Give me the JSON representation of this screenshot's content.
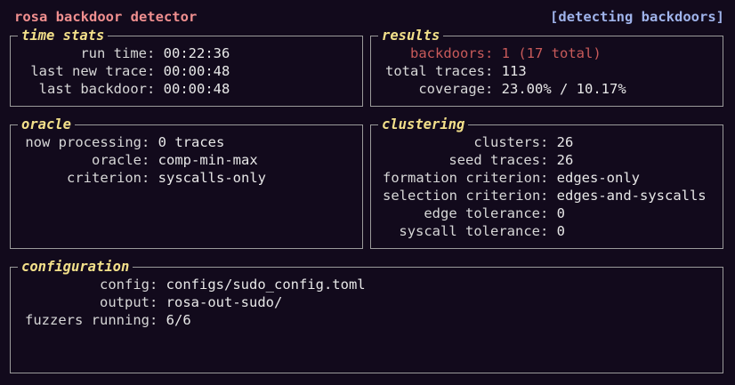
{
  "app": {
    "title": "rosa backdoor detector",
    "status": "[detecting backdoors]"
  },
  "time_stats": {
    "title": "time stats",
    "rows": [
      {
        "label": "run time",
        "value": "00:22:36"
      },
      {
        "label": "last new trace",
        "value": "00:00:48"
      },
      {
        "label": "last backdoor",
        "value": "00:00:48"
      }
    ]
  },
  "results": {
    "title": "results",
    "rows": [
      {
        "label": "backdoors",
        "value": "1 (17 total)"
      },
      {
        "label": "total traces",
        "value": "113"
      },
      {
        "label": "coverage",
        "value": "23.00% / 10.17%"
      }
    ]
  },
  "oracle": {
    "title": "oracle",
    "rows": [
      {
        "label": "now processing",
        "value": "0 traces"
      },
      {
        "label": "oracle",
        "value": "comp-min-max"
      },
      {
        "label": "criterion",
        "value": "syscalls-only"
      }
    ]
  },
  "clustering": {
    "title": "clustering",
    "rows": [
      {
        "label": "clusters",
        "value": "26"
      },
      {
        "label": "seed traces",
        "value": "26"
      },
      {
        "label": "formation criterion",
        "value": "edges-only"
      },
      {
        "label": "selection criterion",
        "value": "edges-and-syscalls"
      },
      {
        "label": "edge tolerance",
        "value": "0"
      },
      {
        "label": "syscall tolerance",
        "value": "0"
      }
    ]
  },
  "configuration": {
    "title": "configuration",
    "rows": [
      {
        "label": "config",
        "value": "configs/sudo_config.toml"
      },
      {
        "label": "output",
        "value": "rosa-out-sudo/"
      },
      {
        "label": "fuzzers running",
        "value": "6/6"
      }
    ]
  },
  "colors": {
    "background": "#120a1c",
    "title": "#f08f8f",
    "status": "#9fb3ea",
    "panel_title": "#f3e08a",
    "border": "#9a9a9a",
    "backdoor_alert": "#c85a5a"
  }
}
